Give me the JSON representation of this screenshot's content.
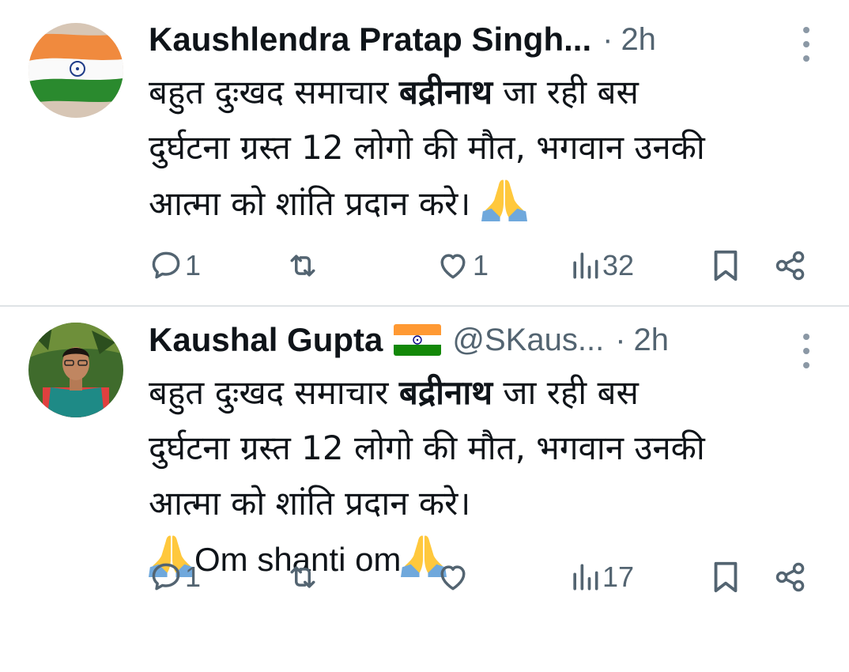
{
  "colors": {
    "text_primary": "#0f1419",
    "text_secondary": "#536471",
    "divider": "#dfe3e6",
    "saffron": "#ff9933",
    "india_green": "#138808",
    "chakra_blue": "#000080"
  },
  "tweets": [
    {
      "author_name": "Kaushlendra Pratap Singh...",
      "dot": "·",
      "time": "2h",
      "avatar_icon": "india-flag-avatar",
      "body_lines": [
        {
          "pre": "बहुत दुःखद समाचार ",
          "bold": "बद्रीनाथ",
          "post": " जा रही बस"
        },
        {
          "pre": "दुर्घटना ग्रस्त 12 लोगो की मौत, भगवान उनकी",
          "bold": "",
          "post": ""
        },
        {
          "pre": "आत्मा को शांति प्रदान करे। ",
          "bold": "",
          "post": ""
        }
      ],
      "reply_count": "1",
      "retweet_count": "",
      "like_count": "1",
      "view_count": "32"
    },
    {
      "author_name": "Kaushal Gupta",
      "handle": "@SKaus...",
      "dot": "·",
      "time": "2h",
      "avatar_icon": "person-photo-avatar",
      "body_lines": [
        {
          "pre": "बहुत दुःखद समाचार ",
          "bold": "बद्रीनाथ",
          "post": " जा रही बस"
        },
        {
          "pre": "दुर्घटना ग्रस्त 12 लोगो की मौत, भगवान उनकी",
          "bold": "",
          "post": ""
        },
        {
          "pre": "आत्मा को शांति प्रदान करे।",
          "bold": "",
          "post": ""
        },
        {
          "pre": "Om shanti om",
          "bold": "",
          "post": ""
        }
      ],
      "reply_count": "1",
      "retweet_count": "",
      "like_count": "",
      "view_count": "17"
    }
  ]
}
